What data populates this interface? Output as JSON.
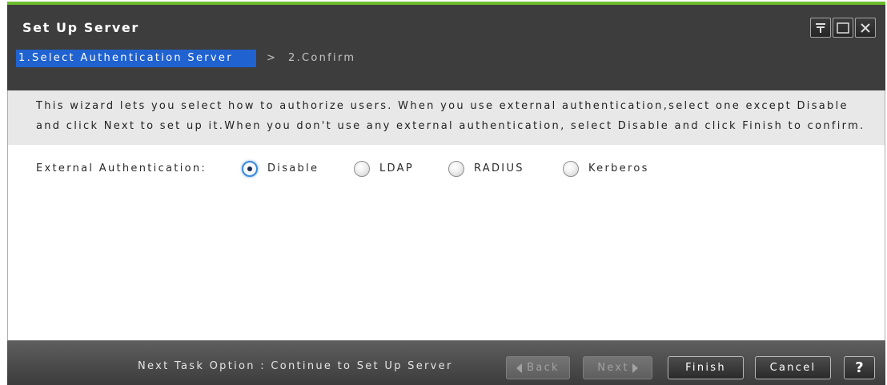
{
  "window": {
    "title": "Set Up Server",
    "controls": {
      "pin_icon": "pin-to-top-icon",
      "maximize_icon": "maximize-icon",
      "close_icon": "close-icon"
    }
  },
  "steps": {
    "items": [
      {
        "label": "1.Select Authentication Server",
        "active": true
      },
      {
        "label": "2.Confirm",
        "active": false
      }
    ],
    "separator": ">"
  },
  "description": {
    "lines": [
      "This wizard lets you select how to authorize users. When you use external authentication,select one except Disable",
      "and click Next to set up it.When you don't use any external authentication, select Disable and click Finish to confirm."
    ]
  },
  "form": {
    "external_authentication": {
      "label": "External Authentication:",
      "options": [
        {
          "label": "Disable",
          "checked": true
        },
        {
          "label": "LDAP",
          "checked": false
        },
        {
          "label": "RADIUS",
          "checked": false
        },
        {
          "label": "Kerberos",
          "checked": false
        }
      ]
    }
  },
  "footer": {
    "next_task_option": "Next Task Option : Continue to Set Up Server",
    "buttons": {
      "back": {
        "label": "Back",
        "enabled": false,
        "icon": "triangle-left-icon"
      },
      "next": {
        "label": "Next",
        "enabled": false,
        "icon": "triangle-right-icon"
      },
      "finish": {
        "label": "Finish",
        "enabled": true
      },
      "cancel": {
        "label": "Cancel",
        "enabled": true
      },
      "help": {
        "label": "?",
        "enabled": true
      }
    }
  },
  "theme": {
    "accent": "#6cbc2c",
    "active_step": "#1f62d0",
    "radio_selected": "#3b8ad8"
  }
}
